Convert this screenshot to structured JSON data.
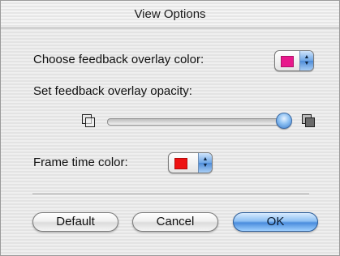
{
  "window": {
    "title": "View Options"
  },
  "feedback_color": {
    "label": "Choose feedback overlay color:",
    "selected_color": "#e8198c"
  },
  "opacity": {
    "label": "Set feedback overlay opacity:",
    "value_fraction": 1.0,
    "min_icon": "transparent-squares-icon",
    "max_icon": "opaque-square-icon"
  },
  "frame_time_color": {
    "label": "Frame time color:",
    "selected_color": "#ee1111"
  },
  "buttons": {
    "default_label": "Default",
    "cancel_label": "Cancel",
    "ok_label": "OK"
  },
  "colors": {
    "accent": "#4a8ddd"
  }
}
